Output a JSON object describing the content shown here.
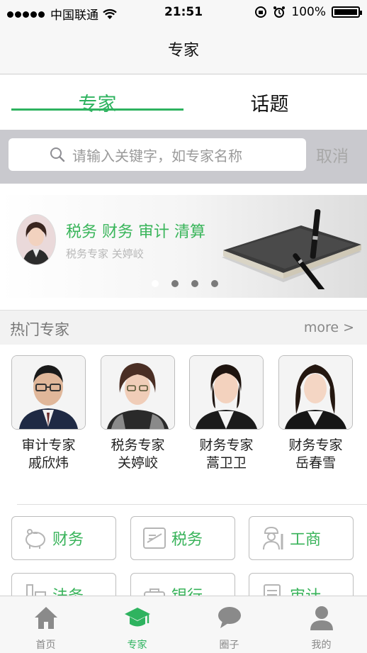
{
  "status_bar": {
    "carrier": "中国联通",
    "time": "21:51",
    "battery": "100%",
    "battery_level": 1.0
  },
  "nav": {
    "title": "专家"
  },
  "segments": {
    "experts": "专家",
    "topics": "话题"
  },
  "search": {
    "placeholder": "请输入关键字，如专家名称",
    "cancel": "取消"
  },
  "banner": {
    "title": "税务 财务 审计 清算",
    "subtitle": "税务专家 关婷峧",
    "page_count": 4,
    "current_page": 1
  },
  "hot_experts": {
    "title": "热门专家",
    "more": "more >",
    "items": [
      {
        "role": "审计专家",
        "name": "戚欣炜"
      },
      {
        "role": "税务专家",
        "name": "关婷峧"
      },
      {
        "role": "财务专家",
        "name": "蒿卫卫"
      },
      {
        "role": "财务专家",
        "name": "岳春雪"
      }
    ]
  },
  "categories": [
    {
      "label": "财务",
      "icon": "piggy-bank-icon"
    },
    {
      "label": "税务",
      "icon": "tax-document-icon"
    },
    {
      "label": "工商",
      "icon": "worker-icon"
    },
    {
      "label": "法务",
      "icon": "law-icon"
    },
    {
      "label": "银行",
      "icon": "bank-icon"
    },
    {
      "label": "审计",
      "icon": "audit-icon"
    }
  ],
  "tab_bar": {
    "items": [
      {
        "label": "首页",
        "icon": "home-icon"
      },
      {
        "label": "专家",
        "icon": "graduation-cap-icon"
      },
      {
        "label": "圈子",
        "icon": "chat-bubble-icon"
      },
      {
        "label": "我的",
        "icon": "person-icon"
      }
    ],
    "active_index": 1
  },
  "colors": {
    "accent": "#2eb35f",
    "category_text": "#38b35a",
    "search_bg": "#c9c9ce"
  }
}
